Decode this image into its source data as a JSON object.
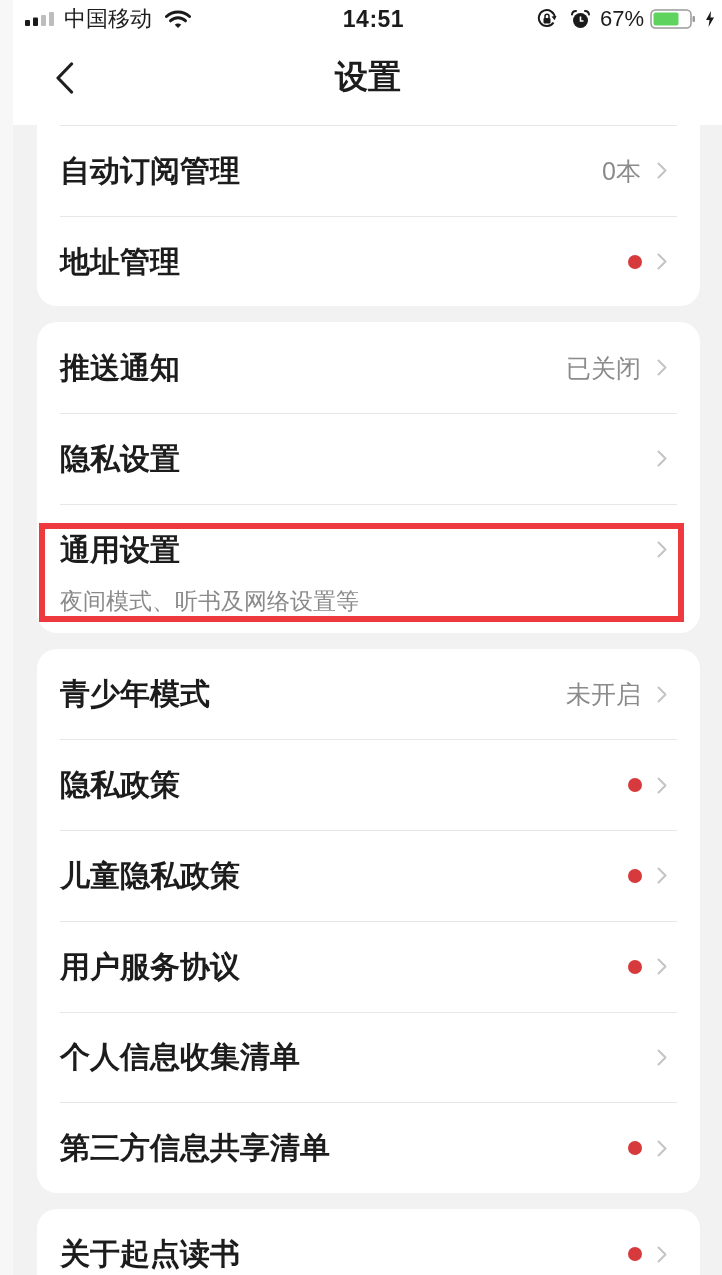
{
  "status_bar": {
    "carrier": "中国移动",
    "time": "14:51",
    "battery_percent": "67%"
  },
  "nav_bar": {
    "title": "设置"
  },
  "groups": [
    {
      "continues_above": true,
      "items": [
        {
          "title": "自动订阅管理",
          "value": "0本",
          "dot": false,
          "highlighted": false
        },
        {
          "title": "地址管理",
          "dot": true,
          "highlighted": false
        }
      ]
    },
    {
      "continues_above": false,
      "items": [
        {
          "title": "推送通知",
          "value": "已关闭",
          "dot": false,
          "highlighted": false
        },
        {
          "title": "隐私设置",
          "dot": false,
          "highlighted": false
        },
        {
          "title": "通用设置",
          "subtitle": "夜间模式、听书及网络设置等",
          "dot": false,
          "highlighted": true
        }
      ]
    },
    {
      "continues_above": false,
      "items": [
        {
          "title": "青少年模式",
          "value": "未开启",
          "dot": false,
          "highlighted": false
        },
        {
          "title": "隐私政策",
          "dot": true,
          "highlighted": false
        },
        {
          "title": "儿童隐私政策",
          "dot": true,
          "highlighted": false
        },
        {
          "title": "用户服务协议",
          "dot": true,
          "highlighted": false
        },
        {
          "title": "个人信息收集清单",
          "dot": false,
          "highlighted": false
        },
        {
          "title": "第三方信息共享清单",
          "dot": true,
          "highlighted": false
        }
      ]
    },
    {
      "continues_above": false,
      "items": [
        {
          "title": "关于起点读书",
          "dot": true,
          "highlighted": false
        }
      ]
    }
  ]
}
